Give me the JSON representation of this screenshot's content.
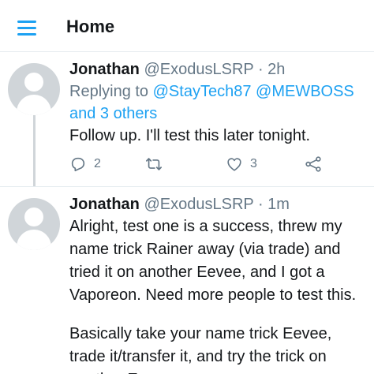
{
  "header": {
    "title": "Home",
    "menu_icon": "hamburger-menu-icon"
  },
  "colors": {
    "accent": "#1da1f2",
    "secondary_text": "#657786",
    "primary_text": "#14171a",
    "avatar_bg": "#d0d5d9",
    "divider": "#e6ecf0"
  },
  "tweets": [
    {
      "name": "Jonathan",
      "handle": "@ExodusLSRP",
      "separator": "·",
      "time": "2h",
      "replying_prefix": "Replying to",
      "mention_1": "@StayTech87",
      "mention_2": "@MEWBOSS",
      "others": "and 3 others",
      "text": "Follow up. I'll test this later tonight.",
      "actions": {
        "reply_icon": "reply-icon",
        "reply_count": "2",
        "retweet_icon": "retweet-icon",
        "like_icon": "heart-icon",
        "like_count": "3",
        "share_icon": "share-icon"
      }
    },
    {
      "name": "Jonathan",
      "handle": "@ExodusLSRP",
      "separator": "·",
      "time": "1m",
      "paragraph_1": "Alright, test one is a success, threw my name trick Rainer away (via trade) and tried it on another Eevee, and I got a Vaporeon. Need more people to test this.",
      "paragraph_2": "Basically take your name trick Eevee, trade it/transfer it, and try the trick on another Eevee."
    }
  ]
}
